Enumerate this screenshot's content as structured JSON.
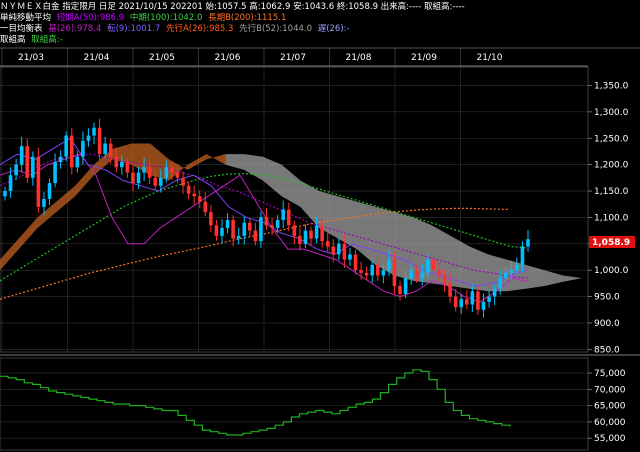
{
  "header": {
    "line1": "ＮＹＭＥＸ白金 指定限月 日足 2021/10/15 202201 始:1057.5 高:1062.9 安:1043.6 終:1058.9 出来高:---- 取組高:----",
    "ma_title": "単純移動平均",
    "ma_short": "短期A(50):986.9",
    "ma_mid": "中期(100):1042.0",
    "ma_long": "長期B(200):1115.1",
    "ichimoku_title": "一目均衡表",
    "kijun": "基(26):978.4",
    "tenkan": "転(9):1001.7",
    "senkou_a": "先行A(26):985.3",
    "senkou_b": "先行B(52):1044.0",
    "chikou": "遅(26):-",
    "oi_title": "取組高",
    "oi_label": "取組高:-"
  },
  "colors": {
    "up": "#00c0ff",
    "down": "#ff3030",
    "ma_short": "#a000c0",
    "ma_mid": "#20c020",
    "ma_long": "#ff7020",
    "kumo_bull": "#c06020",
    "kumo_bear": "#a0a0a0",
    "tenkan": "#8040ff",
    "kijun": "#c020c0",
    "oi": "#20b020",
    "price_box": "#ff2020"
  },
  "chart_data": [
    {
      "type": "candlestick",
      "x_labels": [
        "21/03",
        "21/04",
        "21/05",
        "21/06",
        "21/07",
        "21/08",
        "21/09",
        "21/10"
      ],
      "y_ticks": [
        850,
        900,
        950,
        1000,
        1050,
        1100,
        1150,
        1200,
        1250,
        1300,
        1350
      ],
      "y_tick_labels": [
        "850.0",
        "900.0",
        "950.0",
        "1,000.0",
        "1,050.0",
        "1,100.0",
        "1,150.0",
        "1,200.0",
        "1,250.0",
        "1,300.0",
        "1,350.0"
      ],
      "ylim": [
        845,
        1385
      ],
      "last_price_label": "1,058.9",
      "last_price": 1058.9,
      "close_path": [
        1150,
        1180,
        1200,
        1235,
        1175,
        1215,
        1120,
        1135,
        1165,
        1205,
        1215,
        1255,
        1195,
        1215,
        1245,
        1255,
        1270,
        1220,
        1240,
        1215,
        1195,
        1205,
        1185,
        1165,
        1185,
        1195,
        1175,
        1160,
        1175,
        1195,
        1185,
        1175,
        1160,
        1145,
        1140,
        1130,
        1110,
        1085,
        1065,
        1080,
        1095,
        1060,
        1065,
        1090,
        1075,
        1055,
        1100,
        1085,
        1080,
        1095,
        1115,
        1085,
        1065,
        1050,
        1075,
        1060,
        1085,
        1055,
        1045,
        1030,
        1050,
        1020,
        1030,
        1000,
        995,
        990,
        1010,
        990,
        1000,
        1020,
        970,
        955,
        985,
        1000,
        985,
        995,
        1020,
        1000,
        990,
        975,
        950,
        930,
        945,
        935,
        960,
        925,
        940,
        950,
        965,
        985,
        995,
        1000,
        1010,
        1045,
        1058.9
      ],
      "ma_short": [
        1160,
        1175,
        1195,
        1210,
        1215,
        1220,
        1212,
        1205,
        1200,
        1195,
        1185,
        1175,
        1160,
        1150,
        1135,
        1120,
        1105,
        1090,
        1080,
        1070,
        1060,
        1050,
        1040,
        1030,
        1020,
        1010,
        1000,
        995,
        988,
        985
      ],
      "ma_mid": [
        980,
        1000,
        1020,
        1040,
        1060,
        1080,
        1100,
        1120,
        1135,
        1150,
        1160,
        1170,
        1178,
        1182,
        1183,
        1180,
        1175,
        1165,
        1155,
        1145,
        1135,
        1125,
        1115,
        1105,
        1095,
        1085,
        1075,
        1065,
        1055,
        1045,
        1042
      ],
      "ma_long": [
        945,
        955,
        965,
        975,
        985,
        995,
        1003,
        1012,
        1020,
        1028,
        1035,
        1042,
        1050,
        1058,
        1065,
        1072,
        1080,
        1087,
        1093,
        1098,
        1103,
        1108,
        1111,
        1114,
        1116,
        1117,
        1117,
        1116,
        1115.1
      ],
      "kijun_path": [
        1180,
        1190,
        1180,
        1200,
        1210,
        1220,
        1180,
        1100,
        1050,
        1050,
        1080,
        1100,
        1120,
        1140,
        1160,
        1180,
        1130,
        1080,
        1040,
        1040,
        1030,
        1020,
        1000,
        980,
        960,
        950,
        960,
        980,
        970,
        950,
        940,
        960,
        985,
        978.4
      ],
      "tenkan_path": [
        1200,
        1220,
        1210,
        1230,
        1250,
        1200,
        1190,
        1170,
        1160,
        1150,
        1170,
        1180,
        1160,
        1120,
        1100,
        1090,
        1070,
        1060,
        1040,
        1030,
        1050,
        1040,
        1030,
        1020,
        1000,
        990,
        980,
        970,
        975,
        990,
        1001.7
      ]
    },
    {
      "type": "line",
      "name": "取組高",
      "y_ticks": [
        55000,
        60000,
        65000,
        70000,
        75000
      ],
      "y_tick_labels": [
        "55,000",
        "60,000",
        "65,000",
        "70,000",
        "75,000"
      ],
      "ylim": [
        52000,
        79000
      ],
      "values": [
        74000,
        73500,
        73000,
        72000,
        71500,
        70500,
        69500,
        69000,
        68500,
        68000,
        67500,
        67000,
        66500,
        66000,
        65500,
        65500,
        65000,
        65000,
        64500,
        64000,
        63500,
        63500,
        62000,
        60500,
        59000,
        57500,
        57000,
        56500,
        56000,
        56000,
        56500,
        57000,
        57500,
        58000,
        59000,
        60000,
        61500,
        62500,
        63000,
        63500,
        63000,
        62500,
        63500,
        64500,
        65500,
        66000,
        67000,
        69000,
        71500,
        73500,
        75000,
        76000,
        75500,
        73000,
        70000,
        66000,
        63500,
        62000,
        61000,
        60500,
        60000,
        59500,
        59000,
        58500
      ]
    }
  ]
}
